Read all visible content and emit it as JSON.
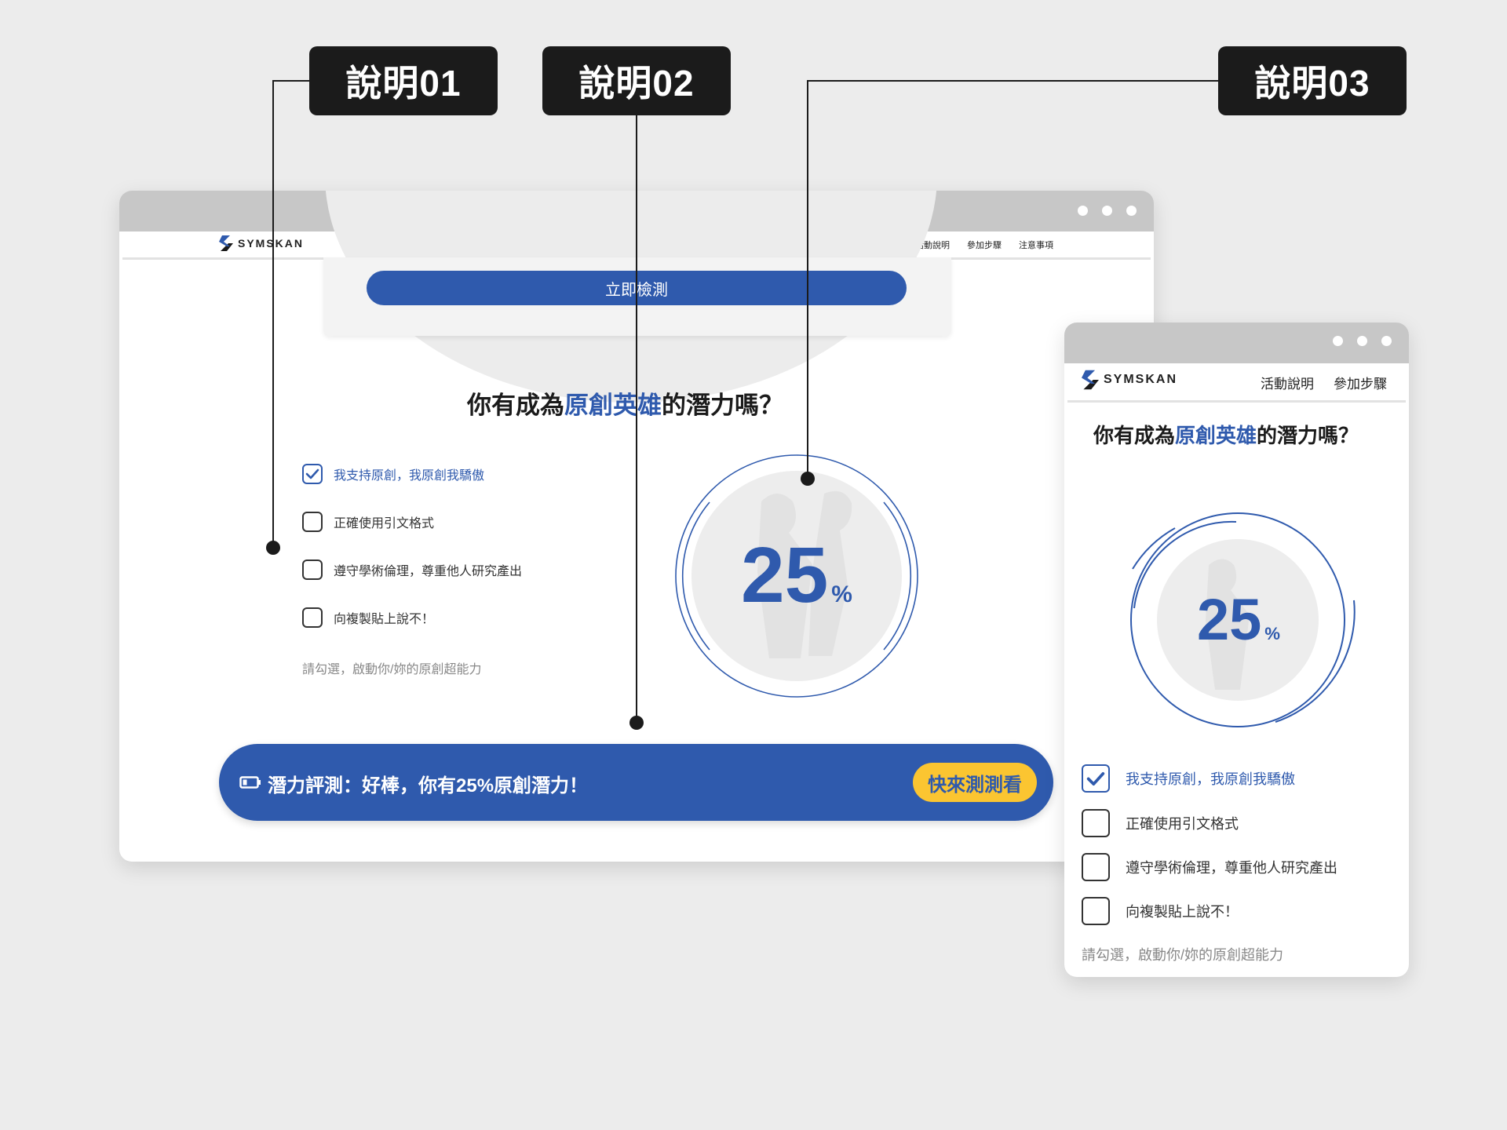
{
  "annotations": [
    {
      "label": "說明01"
    },
    {
      "label": "說明02"
    },
    {
      "label": "說明03"
    }
  ],
  "colors": {
    "brand_blue": "#2f5aad",
    "accent_yellow": "#fbc531",
    "dark": "#1b1b1b"
  },
  "desktop": {
    "logo_text": "SYMSKAN",
    "nav": [
      "活動說明",
      "參加步驟",
      "注意事項"
    ],
    "cta_button": "立即檢測",
    "title_before": "你有成為",
    "title_highlight": "原創英雄",
    "title_after": "的潛力嗎？",
    "checklist": [
      {
        "label": "我支持原創，我原創我驕傲",
        "checked": true
      },
      {
        "label": "正確使用引文格式",
        "checked": false
      },
      {
        "label": "遵守學術倫理，尊重他人研究產出",
        "checked": false
      },
      {
        "label": "向複製貼上說不！",
        "checked": false
      }
    ],
    "hint": "請勾選，啟動你/妳的原創超能力",
    "gauge": {
      "value": "25",
      "unit": "%",
      "fraction": 0.25
    },
    "result_banner": {
      "text": "潛力評測：好棒，你有25%原創潛力！",
      "icon": "battery-icon",
      "button": "快來測測看"
    }
  },
  "mobile": {
    "logo_text": "SYMSKAN",
    "nav": [
      "活動說明",
      "參加步驟"
    ],
    "title_before": "你有成為",
    "title_highlight": "原創英雄",
    "title_after": "的潛力嗎？",
    "gauge": {
      "value": "25",
      "unit": "%",
      "fraction": 0.25
    },
    "checklist": [
      {
        "label": "我支持原創，我原創我驕傲",
        "checked": true
      },
      {
        "label": "正確使用引文格式",
        "checked": false
      },
      {
        "label": "遵守學術倫理，尊重他人研究產出",
        "checked": false
      },
      {
        "label": "向複製貼上說不！",
        "checked": false
      }
    ],
    "hint": "請勾選，啟動你/妳的原創超能力"
  }
}
